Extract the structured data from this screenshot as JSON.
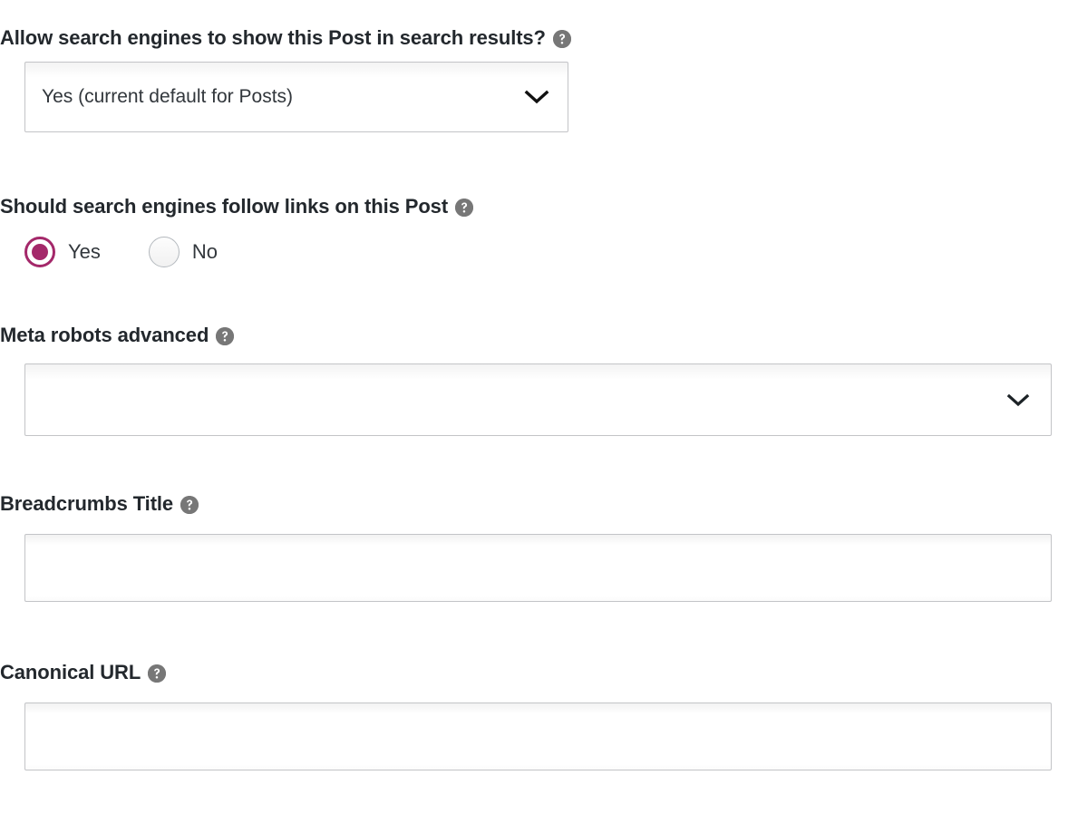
{
  "form": {
    "fields": [
      {
        "id": "indexable",
        "label": "Allow search engines to show this Post in search results?",
        "help_icon": "help-icon",
        "control": "select",
        "selected_value": "Yes (current default for Posts)"
      },
      {
        "id": "nofollow",
        "label": "Should search engines follow links on this Post",
        "help_icon": "help-icon",
        "control": "radio",
        "options": [
          {
            "label": "Yes",
            "checked": true
          },
          {
            "label": "No",
            "checked": false
          }
        ]
      },
      {
        "id": "meta-robots-advanced",
        "label": "Meta robots advanced",
        "help_icon": "help-icon",
        "control": "select",
        "selected_value": ""
      },
      {
        "id": "breadcrumbs-title",
        "label": "Breadcrumbs Title",
        "help_icon": "help-icon",
        "control": "text",
        "value": "",
        "placeholder": ""
      },
      {
        "id": "canonical-url",
        "label": "Canonical URL",
        "help_icon": "help-icon",
        "control": "text",
        "value": "",
        "placeholder": ""
      }
    ]
  },
  "colors": {
    "accent": "#a4286a",
    "label_text": "#23282d",
    "body_text": "#32373c",
    "border": "#c3c4c7",
    "help_icon_bg": "#777777",
    "background": "#ffffff"
  }
}
